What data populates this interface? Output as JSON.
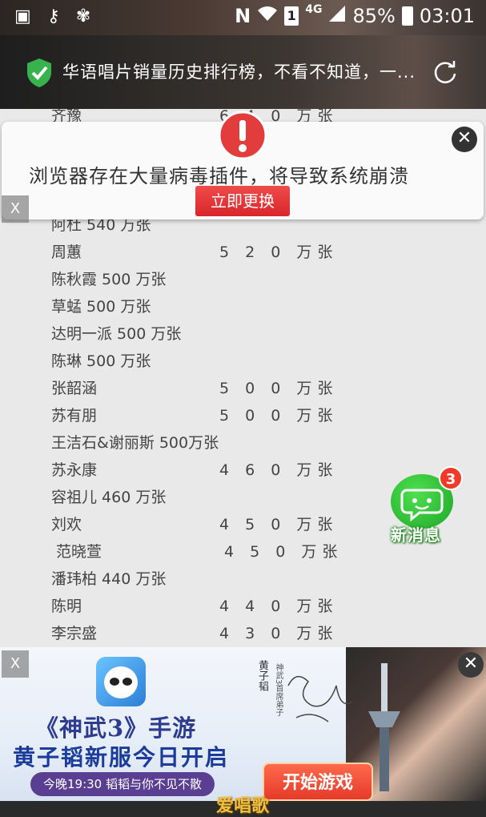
{
  "status_bar": {
    "network": "4G",
    "sim": "1",
    "n_label": "N",
    "battery": "85%",
    "time": "03:01"
  },
  "header": {
    "title": "华语唱片销量历史排行榜，不看不知道，一..."
  },
  "popup": {
    "message": "浏览器存在大量病毒插件，将导致系统崩溃",
    "button": "立即更换",
    "close": "✕",
    "small_close": "X"
  },
  "list": {
    "rows": [
      {
        "name": "齐豫",
        "value": "6 4 0 万张",
        "inline": false,
        "partial": true
      },
      {
        "name": "阿杜",
        "value": "540 万张",
        "inline": true,
        "partial": true
      },
      {
        "name": "周蕙",
        "value": "5 2 0 万张",
        "inline": false
      },
      {
        "name": "陈秋霞",
        "value": "500 万张",
        "inline": true
      },
      {
        "name": "草蜢",
        "value": "500 万张",
        "inline": true
      },
      {
        "name": "达明一派",
        "value": "500 万张",
        "inline": true
      },
      {
        "name": "陈琳",
        "value": "500 万张",
        "inline": true
      },
      {
        "name": "张韶涵",
        "value": "5 0 0 万张",
        "inline": false
      },
      {
        "name": "苏有朋",
        "value": "5 0 0 万张",
        "inline": false
      },
      {
        "name": "王洁石&谢丽斯",
        "value": "500万张",
        "inline": true
      },
      {
        "name": "苏永康",
        "value": "4 6 0 万张",
        "inline": false
      },
      {
        "name": "容祖儿",
        "value": "460 万张",
        "inline": true
      },
      {
        "name": "刘欢",
        "value": "4 5 0 万张",
        "inline": false
      },
      {
        "name": "范晓萱",
        "value": "4 5 0 万张",
        "inline": false,
        "indent": true
      },
      {
        "name": "潘玮柏",
        "value": "440 万张",
        "inline": true
      },
      {
        "name": "陈明",
        "value": "4 4 0 万张",
        "inline": false
      },
      {
        "name": "李宗盛",
        "value": "4 3 0 万张",
        "inline": false
      }
    ]
  },
  "message_bubble": {
    "badge": "3",
    "label": "新消息"
  },
  "ad": {
    "close_left": "X",
    "close_right": "✕",
    "title": "《神武3》手游",
    "subtitle": "黄子韬新服今日开启",
    "pill": "今晚19:30 韬韬与你不见不散",
    "button": "开始游戏",
    "sign_name": "黄子韬",
    "sign_line": "神武3首席弟子"
  },
  "watermark": "爱唱歌",
  "colors": {
    "popup_button": "#d8262a",
    "badge": "#f23a2a",
    "bubble": "#1fa62a",
    "ad_button": "#e53a2a"
  }
}
